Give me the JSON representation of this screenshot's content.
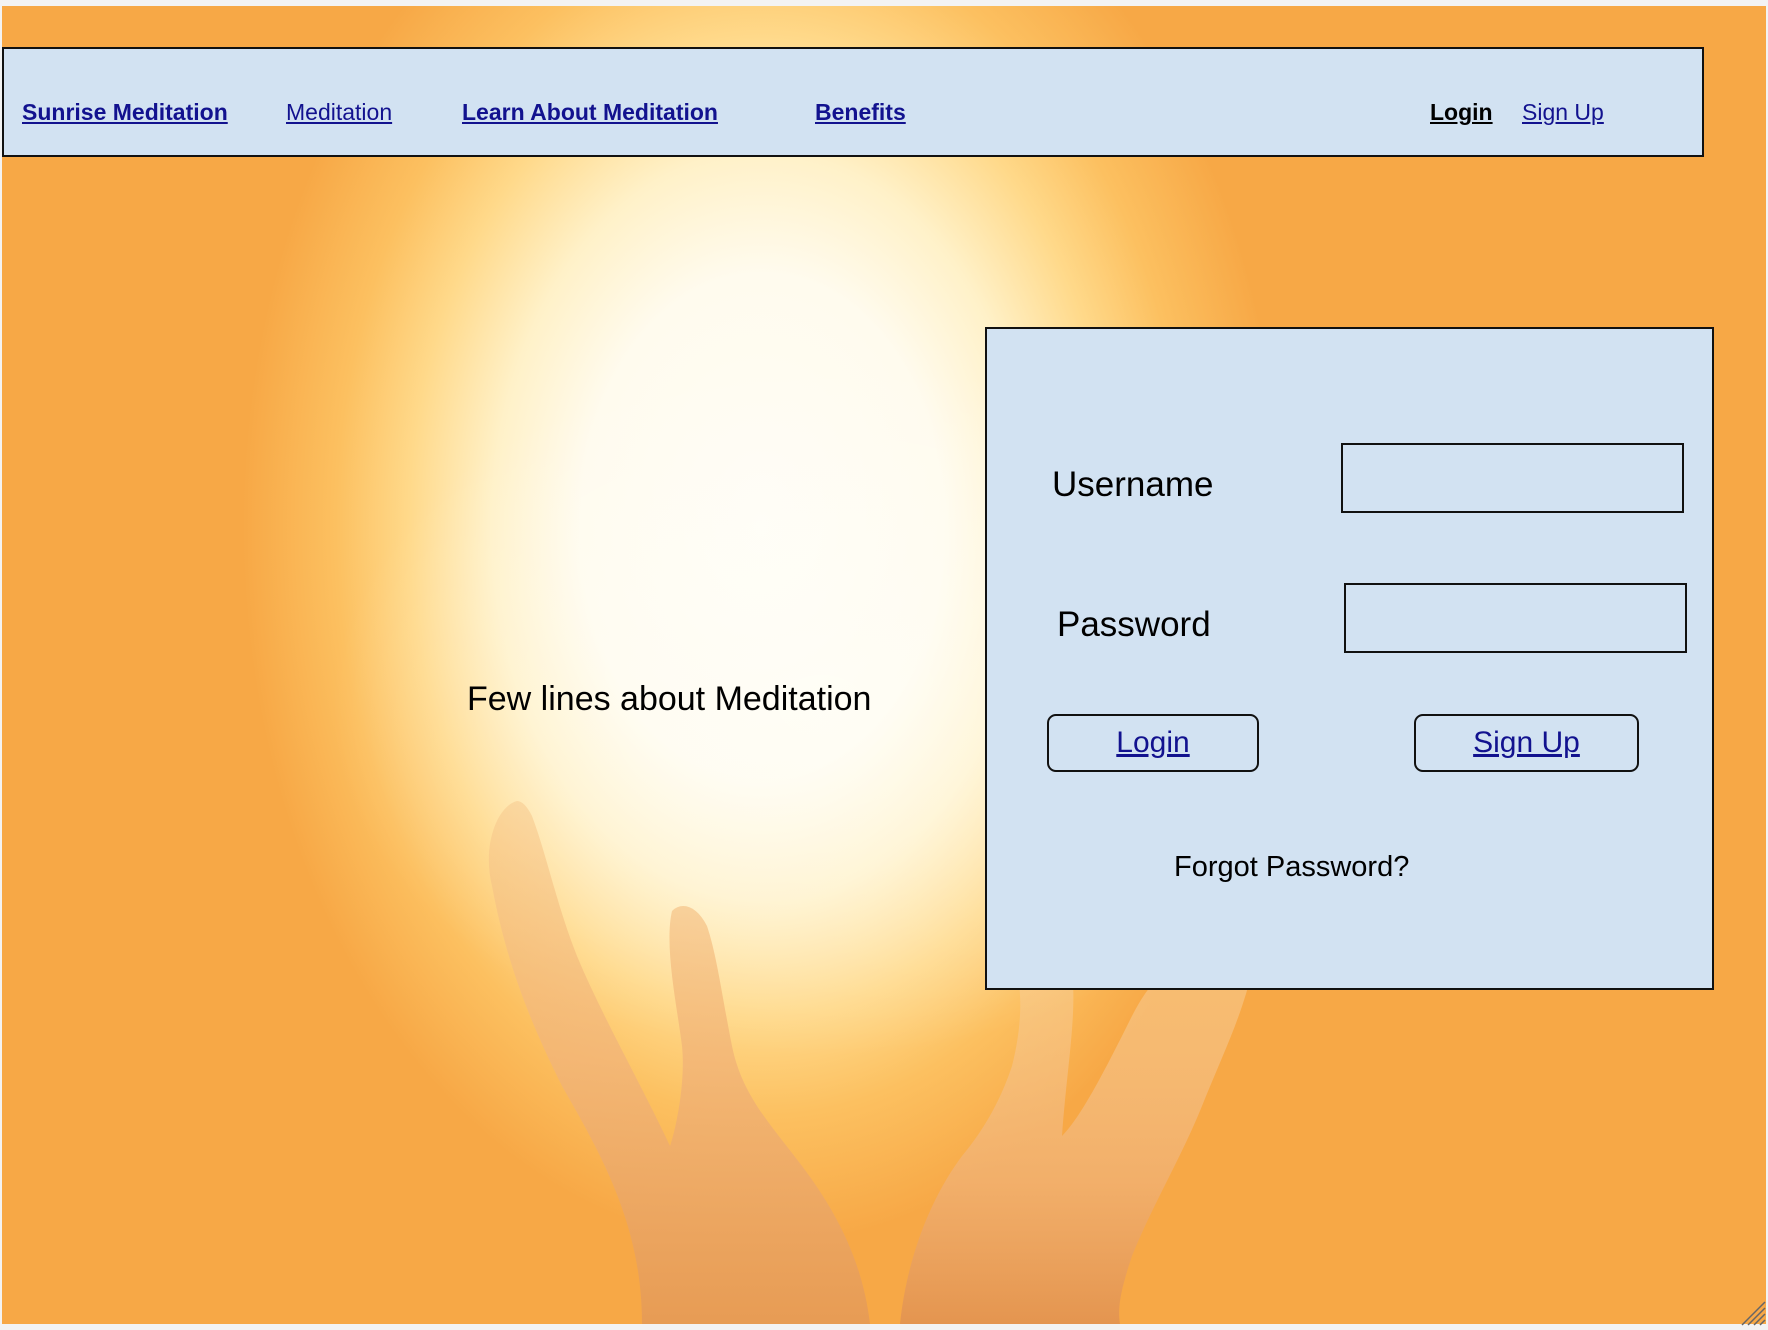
{
  "nav": {
    "brand": "Sunrise Meditation",
    "meditation": "Meditation",
    "learn": "Learn About Meditation",
    "benefits": "Benefits",
    "login": "Login",
    "signup": "Sign Up"
  },
  "hero": {
    "tagline": "Few lines about Meditation"
  },
  "login_form": {
    "username_label": "Username",
    "username_value": "",
    "password_label": "Password",
    "password_value": "",
    "login_button": "Login",
    "signup_button": "Sign Up",
    "forgot_password": "Forgot Password?"
  },
  "colors": {
    "panel_bg": "#d2e2f2",
    "link": "#12128f",
    "sun_orange": "#f7a846"
  },
  "icons": {
    "background": "hands-reaching-sun-image",
    "corner": "resize-grip-icon"
  }
}
